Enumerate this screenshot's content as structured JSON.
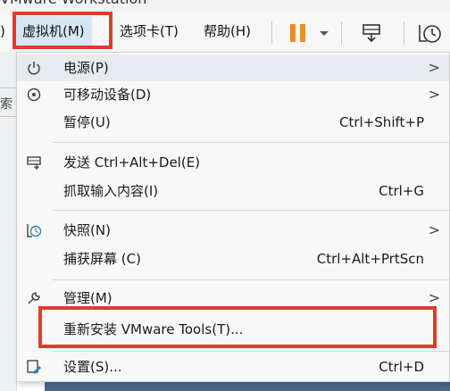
{
  "window": {
    "title": "VMware Workstation"
  },
  "menubar": {
    "items": [
      {
        "label": "虚拟机(M)",
        "active": true
      },
      {
        "label": "选项卡(T)"
      },
      {
        "label": "帮助(H)"
      }
    ]
  },
  "left_panel": {
    "fragment": "索"
  },
  "dropdown": {
    "items": [
      {
        "label": "电源(P)",
        "icon": "power-icon",
        "submenu": true
      },
      {
        "label": "可移动设备(D)",
        "icon": "removable-devices-icon",
        "submenu": true
      },
      {
        "label": "暂停(U)",
        "shortcut": "Ctrl+Shift+P"
      },
      {
        "label": "发送 Ctrl+Alt+Del(E)",
        "icon": "send-keys-icon"
      },
      {
        "label": "抓取输入内容(I)",
        "shortcut": "Ctrl+G"
      },
      {
        "label": "快照(N)",
        "icon": "snapshot-icon",
        "submenu": true
      },
      {
        "label": "捕获屏幕 (C)",
        "shortcut": "Ctrl+Alt+PrtScn"
      },
      {
        "label": "管理(M)",
        "icon": "wrench-icon",
        "submenu": true
      },
      {
        "label": "重新安装 VMware Tools(T)..."
      },
      {
        "label": "设置(S)...",
        "icon": "settings-icon",
        "shortcut": "Ctrl+D"
      }
    ],
    "submenu_arrow": ">"
  },
  "highlight_color": "#e03c2a",
  "accent_pause_color": "#f08a24"
}
